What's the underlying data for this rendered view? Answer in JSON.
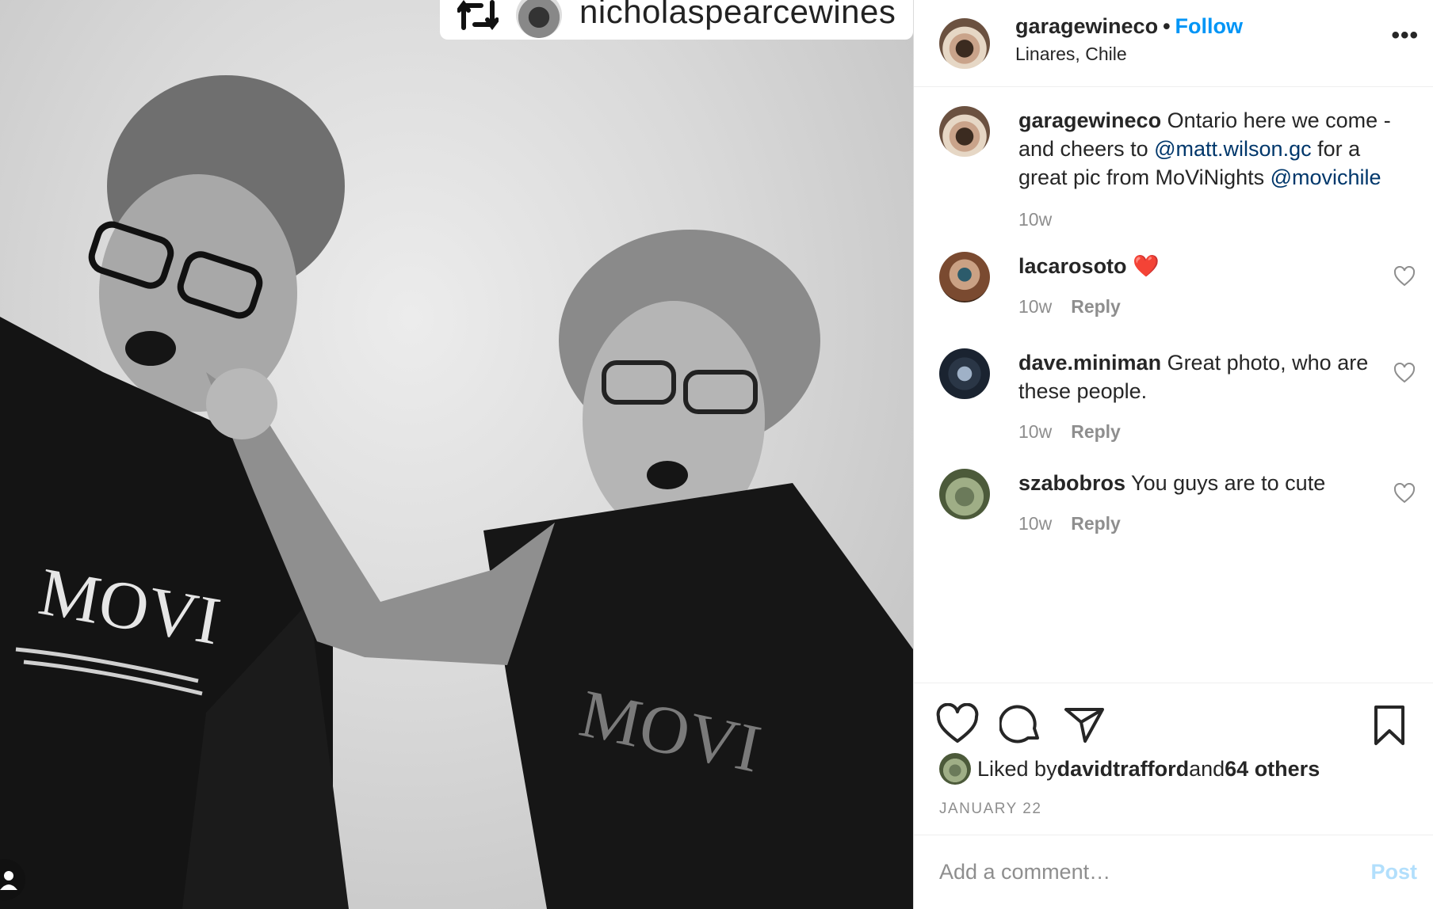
{
  "photo": {
    "repost_username": "nicholaspearcewines",
    "shirt_text_left": "MOVI",
    "shirt_text_right": "MOVI"
  },
  "header": {
    "username": "garagewineco",
    "separator": "•",
    "follow_label": "Follow",
    "location": "Linares, Chile",
    "more_label": "•••"
  },
  "caption": {
    "username": "garagewineco",
    "text_1": " Ontario here we come - and cheers to ",
    "mention_1": "@matt.wilson.gc",
    "text_2": " for a great pic from MoViNights ",
    "mention_2": "@movichile",
    "time": "10w"
  },
  "comments": [
    {
      "username": "lacarosoto",
      "text": " ❤️",
      "time": "10w",
      "reply_label": "Reply"
    },
    {
      "username": "dave.miniman",
      "text": " Great photo, who are these people.",
      "time": "10w",
      "reply_label": "Reply"
    },
    {
      "username": "szabobros",
      "text": " You guys are to cute",
      "time": "10w",
      "reply_label": "Reply"
    }
  ],
  "likes": {
    "prefix": "Liked by ",
    "user": "davidtrafford",
    "middle": " and ",
    "others": "64 others"
  },
  "date": "JANUARY 22",
  "add_comment": {
    "placeholder": "Add a comment…",
    "post_label": "Post"
  },
  "colors": {
    "follow": "#0095f6",
    "mention": "#00376b",
    "muted": "#8e8e8e",
    "post_disabled": "#b2dffc"
  }
}
